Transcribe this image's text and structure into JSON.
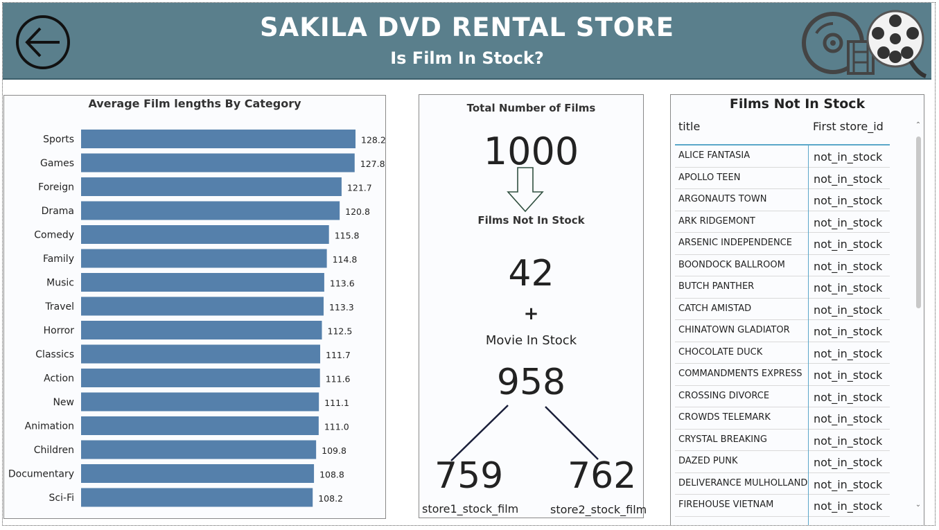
{
  "header": {
    "title": "SAKILA DVD RENTAL STORE",
    "subtitle": "Is Film In Stock?"
  },
  "colors": {
    "header_bg": "#5a7f8c",
    "bar": "#5580ab",
    "accent_line": "#5aa7c9"
  },
  "icons": {
    "back": "back-arrow-icon",
    "logo": "film-reel-icon"
  },
  "chart_data": {
    "type": "bar",
    "orientation": "horizontal",
    "title": "Average Film lengths By Category",
    "categories": [
      "Sports",
      "Games",
      "Foreign",
      "Drama",
      "Comedy",
      "Family",
      "Music",
      "Travel",
      "Horror",
      "Classics",
      "Action",
      "New",
      "Animation",
      "Children",
      "Documentary",
      "Sci-Fi"
    ],
    "values": [
      128.2,
      127.8,
      121.7,
      120.8,
      115.8,
      114.8,
      113.6,
      113.3,
      112.5,
      111.7,
      111.6,
      111.1,
      111.0,
      109.8,
      108.8,
      108.2
    ],
    "value_labels": [
      "128.2",
      "127.8",
      "121.7",
      "120.8",
      "115.8",
      "114.8",
      "113.6",
      "113.3",
      "112.5",
      "111.7",
      "111.6",
      "111.1",
      "111.0",
      "109.8",
      "108.8",
      "108.2"
    ],
    "xlim": [
      0,
      140
    ],
    "grid": false,
    "legend": "none"
  },
  "kpi": {
    "total_label": "Total Number of Films",
    "total_value": "1000",
    "not_in_stock_label": "Films Not In Stock",
    "not_in_stock_value": "42",
    "plus": "+",
    "in_stock_label": "Movie In Stock",
    "in_stock_value": "958",
    "store1_value": "759",
    "store1_label": "store1_stock_film",
    "store2_value": "762",
    "store2_label": "store2_stock_film"
  },
  "table": {
    "title": "Films Not In Stock",
    "headers": [
      "title",
      "First store_id"
    ],
    "rows": [
      [
        "ALICE FANTASIA",
        "not_in_stock"
      ],
      [
        "APOLLO TEEN",
        "not_in_stock"
      ],
      [
        "ARGONAUTS TOWN",
        "not_in_stock"
      ],
      [
        "ARK RIDGEMONT",
        "not_in_stock"
      ],
      [
        "ARSENIC INDEPENDENCE",
        "not_in_stock"
      ],
      [
        "BOONDOCK BALLROOM",
        "not_in_stock"
      ],
      [
        "BUTCH PANTHER",
        "not_in_stock"
      ],
      [
        "CATCH AMISTAD",
        "not_in_stock"
      ],
      [
        "CHINATOWN GLADIATOR",
        "not_in_stock"
      ],
      [
        "CHOCOLATE DUCK",
        "not_in_stock"
      ],
      [
        "COMMANDMENTS EXPRESS",
        "not_in_stock"
      ],
      [
        "CROSSING DIVORCE",
        "not_in_stock"
      ],
      [
        "CROWDS TELEMARK",
        "not_in_stock"
      ],
      [
        "CRYSTAL BREAKING",
        "not_in_stock"
      ],
      [
        "DAZED PUNK",
        "not_in_stock"
      ],
      [
        "DELIVERANCE MULHOLLAND",
        "not_in_stock"
      ],
      [
        "FIREHOUSE VIETNAM",
        "not_in_stock"
      ]
    ]
  }
}
